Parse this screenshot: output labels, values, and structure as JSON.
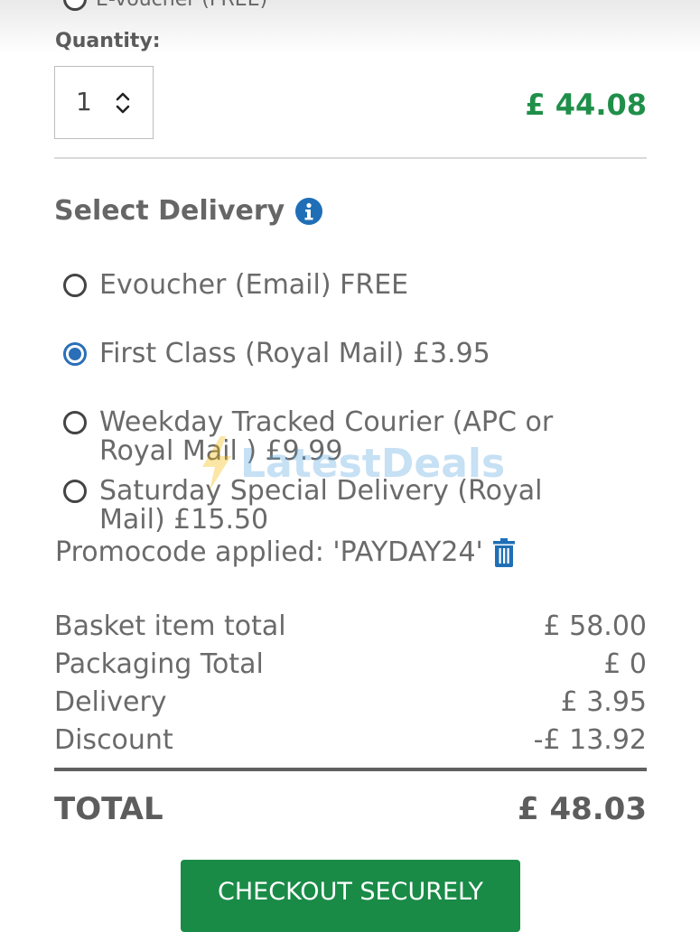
{
  "previous_option": {
    "label": "E-voucher (FREE)"
  },
  "quantity": {
    "label": "Quantity:",
    "value": "1"
  },
  "line_price": "£ 44.08",
  "delivery": {
    "title": "Select Delivery",
    "options": [
      {
        "label": "Evoucher (Email) FREE",
        "selected": false
      },
      {
        "label": "First Class (Royal Mail) £3.95",
        "selected": true
      },
      {
        "label": "Weekday Tracked Courier (APC or Royal Mail ) £9.99",
        "selected": false
      },
      {
        "label": "Saturday Special Delivery (Royal Mail) £15.50",
        "selected": false
      }
    ]
  },
  "promo": {
    "text": "Promocode applied: 'PAYDAY24'"
  },
  "summary": {
    "rows": [
      {
        "label": "Basket item total",
        "value": "£ 58.00"
      },
      {
        "label": "Packaging Total",
        "value": "£ 0"
      },
      {
        "label": "Delivery",
        "value": "£ 3.95"
      },
      {
        "label": "Discount",
        "value": "-£ 13.92"
      }
    ],
    "total_label": "TOTAL",
    "total_value": "£ 48.03"
  },
  "checkout_label": "CHECKOUT SECURELY",
  "watermark": "LatestDeals",
  "colors": {
    "green": "#198b47",
    "blue": "#2a6fb7",
    "text": "#6a6a6a"
  }
}
